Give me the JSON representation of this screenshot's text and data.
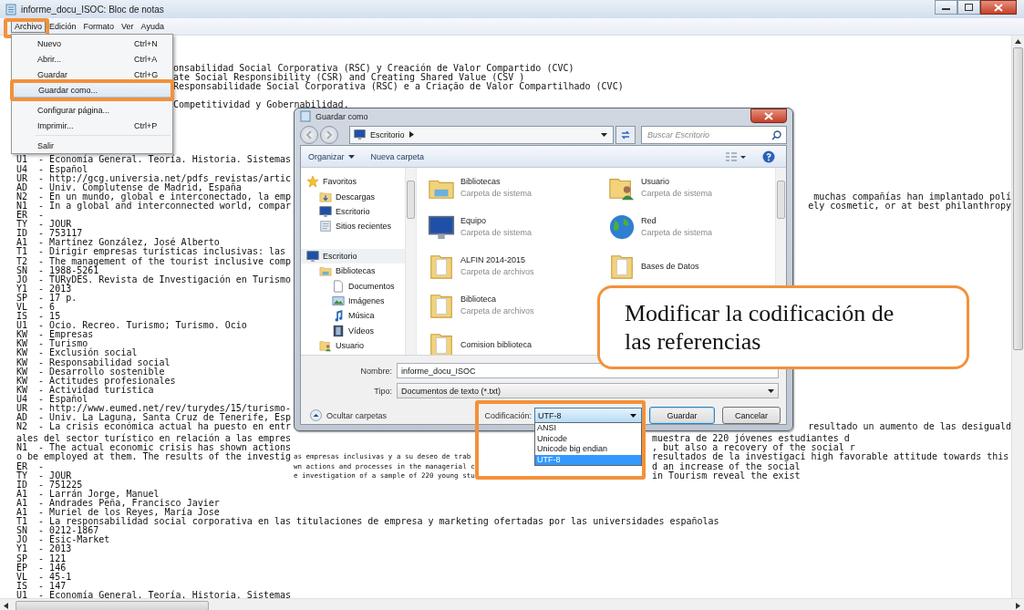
{
  "notepad": {
    "title": "informe_docu_ISOC: Bloc de notas",
    "menu_bar": [
      {
        "label": "Archivo",
        "selected": true,
        "framed": true
      },
      {
        "label": "Edición",
        "selected": false,
        "framed": false
      },
      {
        "label": "Formato",
        "selected": false,
        "framed": false
      },
      {
        "label": "Ver",
        "selected": false,
        "framed": false
      },
      {
        "label": "Ayuda",
        "selected": false,
        "framed": false
      }
    ],
    "file_menu": [
      {
        "kind": "item",
        "label": "Nuevo",
        "shortcut": "Ctrl+N",
        "highlighted": false,
        "framed": false
      },
      {
        "kind": "item",
        "label": "Abrir...",
        "shortcut": "Ctrl+A",
        "highlighted": false,
        "framed": false
      },
      {
        "kind": "item",
        "label": "Guardar",
        "shortcut": "Ctrl+G",
        "highlighted": false,
        "framed": false
      },
      {
        "kind": "item",
        "label": "Guardar como...",
        "highlighted": true,
        "framed": true
      },
      {
        "kind": "separator"
      },
      {
        "kind": "item",
        "label": "Configurar página...",
        "highlighted": false,
        "framed": false
      },
      {
        "kind": "item",
        "label": "Imprimir...",
        "shortcut": "Ctrl+P",
        "highlighted": false,
        "framed": false
      },
      {
        "kind": "separator"
      },
      {
        "kind": "item",
        "label": "Salir",
        "highlighted": false,
        "framed": false
      }
    ],
    "lines_beside_menu": [
      "onsabilidad Social Corporativa (RSC) y Creación de Valor Compartido (CVC)",
      "ate Social Responsibility (CSR) and Creating Shared Value (CSV )",
      "Responsabilidade Social Corporativa (RSC) e a Criação de Valor Compartilhado (CVC)",
      "Competitividad y Gobernabilidad."
    ],
    "lines_beside_dialog": [
      {
        "left": "U1  - Economía General. Teoría. Historia. Sistemas"
      },
      {
        "left": "U4  - Español"
      },
      {
        "left": "UR  - http://gcg.universia.net/pdfs_revistas/artic"
      },
      {
        "left": "AD  - Univ. Complutense de Madrid, España"
      },
      {
        "left": "N2  - En un mundo, global e interconectado, la emp",
        "right": "muchas compañías han implantado polí"
      },
      {
        "left": "N1  - In a global and interconnected world, compar",
        "right": "ely cosmetic, or at best philanthropy"
      },
      {
        "left": "ER  -"
      },
      {
        "left": "TY  - JOUR"
      },
      {
        "left": "ID  - 753117"
      },
      {
        "left": "A1  - Martínez González, José Alberto"
      },
      {
        "left": "T1  - Dirigir empresas turísticas inclusivas: las"
      },
      {
        "left": "T2  - The management of the tourist inclusive comp"
      },
      {
        "left": "SN  - 1988-5261"
      },
      {
        "left": "JO  - TURyDES. Revista de Investigación en Turismo"
      },
      {
        "left": "Y1  - 2013"
      },
      {
        "left": "SP  - 17 p."
      },
      {
        "left": "VL  - 6"
      },
      {
        "left": "IS  - 15"
      },
      {
        "left": "U1  - Ocio. Recreo. Turismo; Turismo. Ocio"
      },
      {
        "left": "KW  - Empresas"
      },
      {
        "left": "KW  - Turismo"
      },
      {
        "left": "KW  - Exclusión social"
      },
      {
        "left": "KW  - Responsabilidad social"
      },
      {
        "left": "KW  - Desarrollo sostenible"
      },
      {
        "left": "KW  - Actitudes profesionales"
      },
      {
        "left": "KW  - Actividad turística"
      },
      {
        "left": "U4  - Español"
      },
      {
        "left": "UR  - http://www.eumed.net/rev/turydes/15/turismo-"
      },
      {
        "left": "AD  - Univ. La Laguna, Santa Cruz de Tenerife, Esp"
      },
      {
        "left": "N2  - La crisis económica actual ha puesto en entr",
        "right": "resultado un aumento de las desiguald"
      }
    ],
    "lines_below_dialog": [
      {
        "left": "ales del sector turístico en relación a las empres",
        "right": "muestra de 220 jóvenes estudiantes d"
      },
      {
        "left": "N1  - The actual economic crisis has shown actions",
        "right": ", but also a recovery of the social r"
      },
      {
        "left": "o be employed at them. The results of the investig",
        "middle": "as empresas inclusivas y a su deseo de trab",
        "right": "resultados de la investigaci high favorable attitude towards this"
      },
      {
        "left": "ER  -",
        "middle": "wn actions and processes in the managerial c",
        "right": "d an increase of the social"
      },
      {
        "left": "TY  - JOUR",
        "middle": "e investigation of a sample of 220 young stu",
        "right": "in Tourism reveal the exist"
      }
    ],
    "lines": [
      "ID  - 751225",
      "A1  - Larrán Jorge, Manuel",
      "A1  - Andrades Peña, Francisco Javier",
      "A1  - Muriel de los Reyes, María Jose",
      "T1  - La responsabilidad social corporativa en las titulaciones de empresa y marketing ofertadas por las universidades españolas",
      "SN  - 0212-1867",
      "JO  - Esic-Market",
      "Y1  - 2013",
      "SP  - 121",
      "EP  - 146",
      "VL  - 45-1",
      "IS  - 147",
      "U1  - Economía General. Teoría. Historia. Sistemas"
    ]
  },
  "save_dialog": {
    "title": "Guardar como",
    "address": "Escritorio",
    "search": {
      "placeholder": "Buscar Escritorio"
    },
    "toolbar": [
      "Organizar",
      "Nueva carpeta"
    ],
    "nav": [
      {
        "label": "Favoritos",
        "children": [
          {
            "label": "Descargas"
          },
          {
            "label": "Escritorio"
          },
          {
            "label": "Sitios recientes"
          }
        ]
      },
      {
        "label": "Escritorio",
        "children": [
          {
            "label": "Bibliotecas",
            "children": [
              {
                "label": "Documentos"
              },
              {
                "label": "Imágenes"
              },
              {
                "label": "Música"
              },
              {
                "label": "Vídeos"
              }
            ]
          },
          {
            "label": "Usuario"
          }
        ]
      }
    ],
    "files": [
      {
        "name": "Bibliotecas",
        "type": "Carpeta de sistema"
      },
      {
        "name": "Usuario",
        "type": "Carpeta de sistema"
      },
      {
        "name": "Equipo",
        "type": "Carpeta de sistema"
      },
      {
        "name": "Red",
        "type": "Carpeta de sistema"
      },
      {
        "name": "ALFIN 2014-2015",
        "type": "Carpeta de archivos"
      },
      {
        "name": "Bases de Datos"
      },
      {
        "name": "Biblioteca",
        "type": "Carpeta de archivos"
      },
      {
        "name": "Comision biblioteca"
      }
    ],
    "name_field": {
      "label": "Nombre:",
      "value": "informe_docu_ISOC"
    },
    "type_field": {
      "label": "Tipo:",
      "value": "Documentos de texto (*.txt)"
    },
    "hide_folders": "Ocultar carpetas",
    "encoding": {
      "label": "Codificación:",
      "value": "UTF-8",
      "framed": true,
      "expanded": true,
      "options": [
        {
          "label": "ANSI",
          "selected": false
        },
        {
          "label": "Unicode",
          "selected": false
        },
        {
          "label": "Unicode big endian",
          "selected": false
        },
        {
          "label": "UTF-8",
          "selected": true
        }
      ]
    },
    "buttons": [
      {
        "label": "Guardar",
        "default": true
      },
      {
        "label": "Cancelar",
        "default": false
      }
    ]
  },
  "callout": {
    "text": "Modificar la codificación de las referencias"
  }
}
